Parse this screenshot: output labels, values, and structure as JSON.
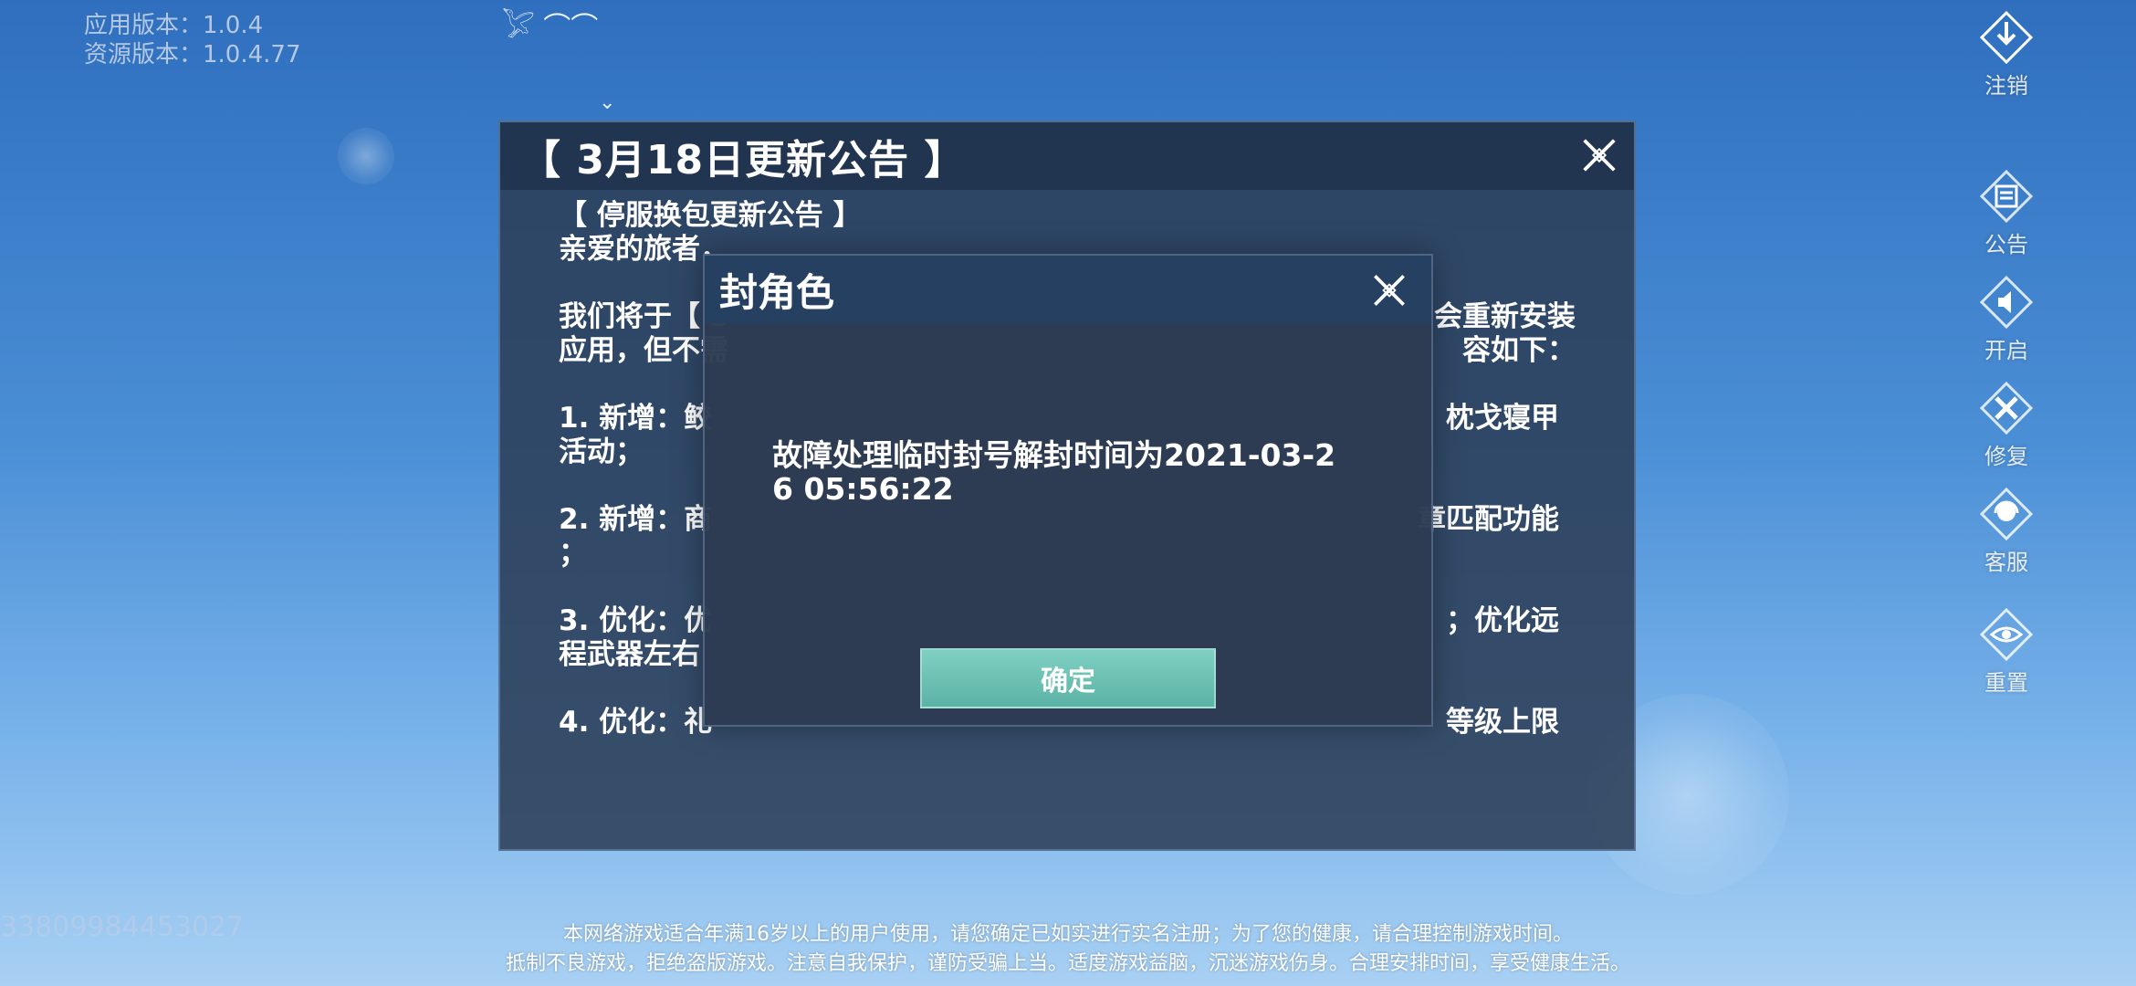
{
  "version": {
    "app": "应用版本：1.0.4",
    "resource": "资源版本：1.0.4.77"
  },
  "uid": "33809984453027",
  "side_menu": [
    {
      "label": "注销",
      "icon": "logout-icon"
    },
    {
      "label": "公告",
      "icon": "notice-icon"
    },
    {
      "label": "开启",
      "icon": "speaker-icon"
    },
    {
      "label": "修复",
      "icon": "repair-icon"
    },
    {
      "label": "客服",
      "icon": "customer-service-icon"
    },
    {
      "label": "重置",
      "icon": "reset-eye-icon"
    }
  ],
  "notice": {
    "title": "【 3月18日更新公告 】",
    "lines": [
      "【 停服换包更新公告 】",
      "亲爱的旅者，",
      "我们将于【 3",
      "会重新安装",
      "应用，但不需",
      "容如下：",
      "1. 新增：鲛",
      "枕戈寝甲",
      "活动；",
      "2. 新增：商",
      "章匹配功能",
      "；",
      "3. 优化：优",
      "；优化远",
      "程武器左右",
      "4. 优化：礼",
      "等级上限"
    ]
  },
  "modal": {
    "title": "封角色",
    "message": "故障处理临时封号解封时间为2021-03-26 05:56:22",
    "confirm_label": "确定"
  },
  "footer": {
    "line1": "本网络游戏适合年满16岁以上的用户使用，请您确定已如实进行实名注册；为了您的健康，请合理控制游戏时间。",
    "line2": "抵制不良游戏，拒绝盗版游戏。注意自我保护，谨防受骗上当。适度游戏益脑，沉迷游戏伤身。合理安排时间，享受健康生活。"
  }
}
